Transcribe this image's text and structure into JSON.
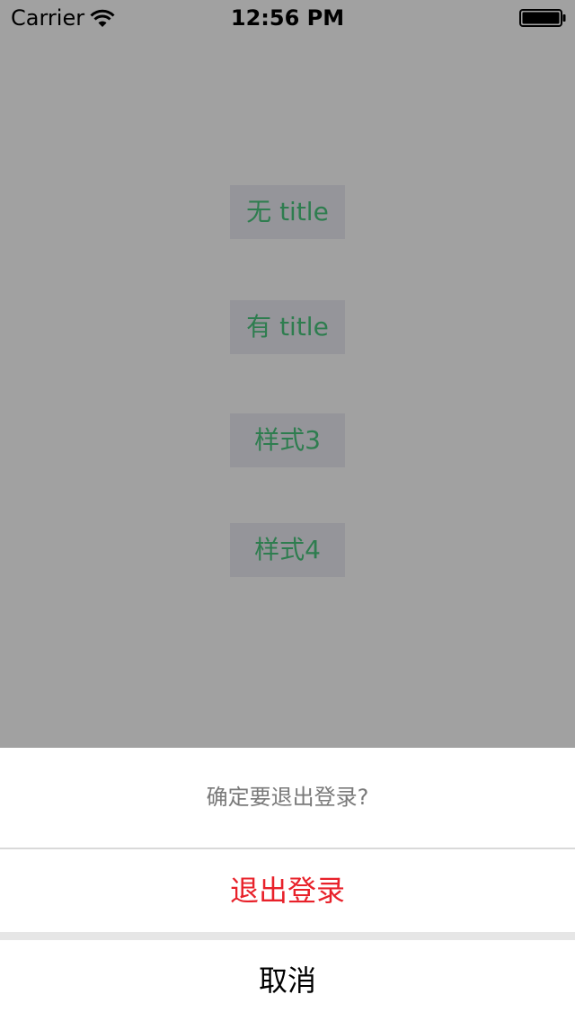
{
  "status_bar": {
    "carrier": "Carrier",
    "time": "12:56 PM"
  },
  "buttons": [
    {
      "label": "无 title"
    },
    {
      "label": "有 title"
    },
    {
      "label": "样式3"
    },
    {
      "label": "样式4"
    }
  ],
  "action_sheet": {
    "title": "确定要退出登录?",
    "destructive_label": "退出登录",
    "cancel_label": "取消"
  },
  "colors": {
    "overlay": "#a1a1a1",
    "button_bg": "#95959a",
    "button_text": "#2e7d4f",
    "destructive": "#e8212a",
    "title_text": "#7a7a7a"
  }
}
